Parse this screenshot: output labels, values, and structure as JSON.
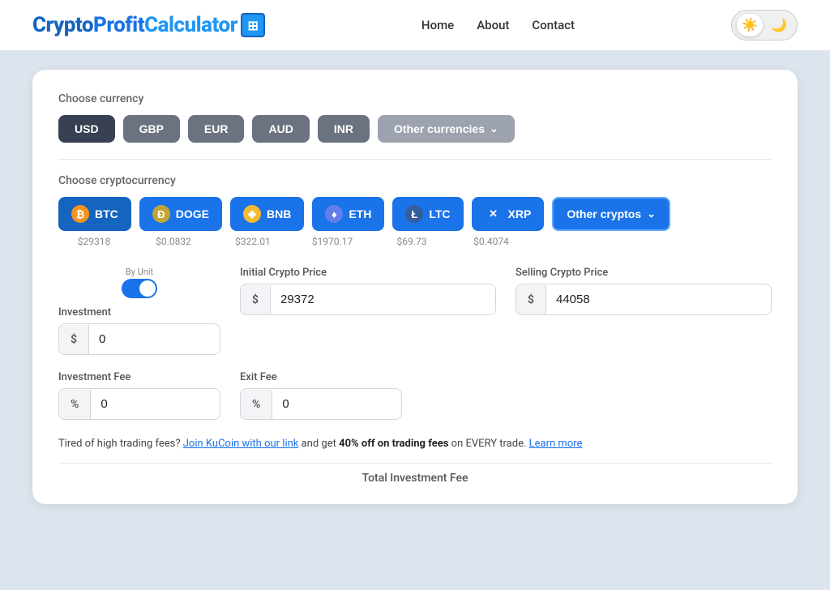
{
  "nav": {
    "logo": {
      "crypto": "Crypto",
      "profit": "Profit",
      "calculator": "Calculator",
      "icon": "▦"
    },
    "links": [
      {
        "label": "Home",
        "href": "#"
      },
      {
        "label": "About",
        "href": "#"
      },
      {
        "label": "Contact",
        "href": "#"
      }
    ],
    "theme": {
      "sun": "☀️",
      "moon": "🌙"
    }
  },
  "currency": {
    "section_label": "Choose currency",
    "buttons": [
      "USD",
      "GBP",
      "EUR",
      "AUD",
      "INR"
    ],
    "other_label": "Other currencies",
    "active": "USD"
  },
  "crypto": {
    "section_label": "Choose cryptocurrency",
    "coins": [
      {
        "id": "BTC",
        "label": "BTC",
        "price": "$29318",
        "icon": "₿",
        "icon_class": "btc-icon"
      },
      {
        "id": "DOGE",
        "label": "DOGE",
        "price": "$0.0832",
        "icon": "Ð",
        "icon_class": "doge-icon"
      },
      {
        "id": "BNB",
        "label": "BNB",
        "price": "$322.01",
        "icon": "◆",
        "icon_class": "bnb-icon"
      },
      {
        "id": "ETH",
        "label": "ETH",
        "price": "$1970.17",
        "icon": "♦",
        "icon_class": "eth-icon"
      },
      {
        "id": "LTC",
        "label": "LTC",
        "price": "$69.73",
        "icon": "Ł",
        "icon_class": "ltc-icon"
      },
      {
        "id": "XRP",
        "label": "XRP",
        "price": "$0.4074",
        "icon": "✕",
        "icon_class": "xrp-icon"
      }
    ],
    "other_label": "Other cryptos",
    "active": "BTC"
  },
  "inputs": {
    "investment": {
      "label": "Investment",
      "toggle_label": "By Unit",
      "prefix": "$",
      "value": "0"
    },
    "initial_price": {
      "label": "Initial Crypto Price",
      "prefix": "$",
      "value": "29372"
    },
    "selling_price": {
      "label": "Selling Crypto Price",
      "prefix": "$",
      "value": "44058"
    },
    "investment_fee": {
      "label": "Investment Fee",
      "prefix": "%",
      "value": "0"
    },
    "exit_fee": {
      "label": "Exit Fee",
      "prefix": "%",
      "value": "0"
    }
  },
  "promo": {
    "text_before": "Tired of high trading fees?",
    "link1_label": "Join KuCoin with our link",
    "text_mid": "and get",
    "bold": "40% off on trading fees",
    "text_after": "on EVERY trade.",
    "link2_label": "Learn more"
  },
  "total": {
    "label": "Total Investment Fee"
  }
}
